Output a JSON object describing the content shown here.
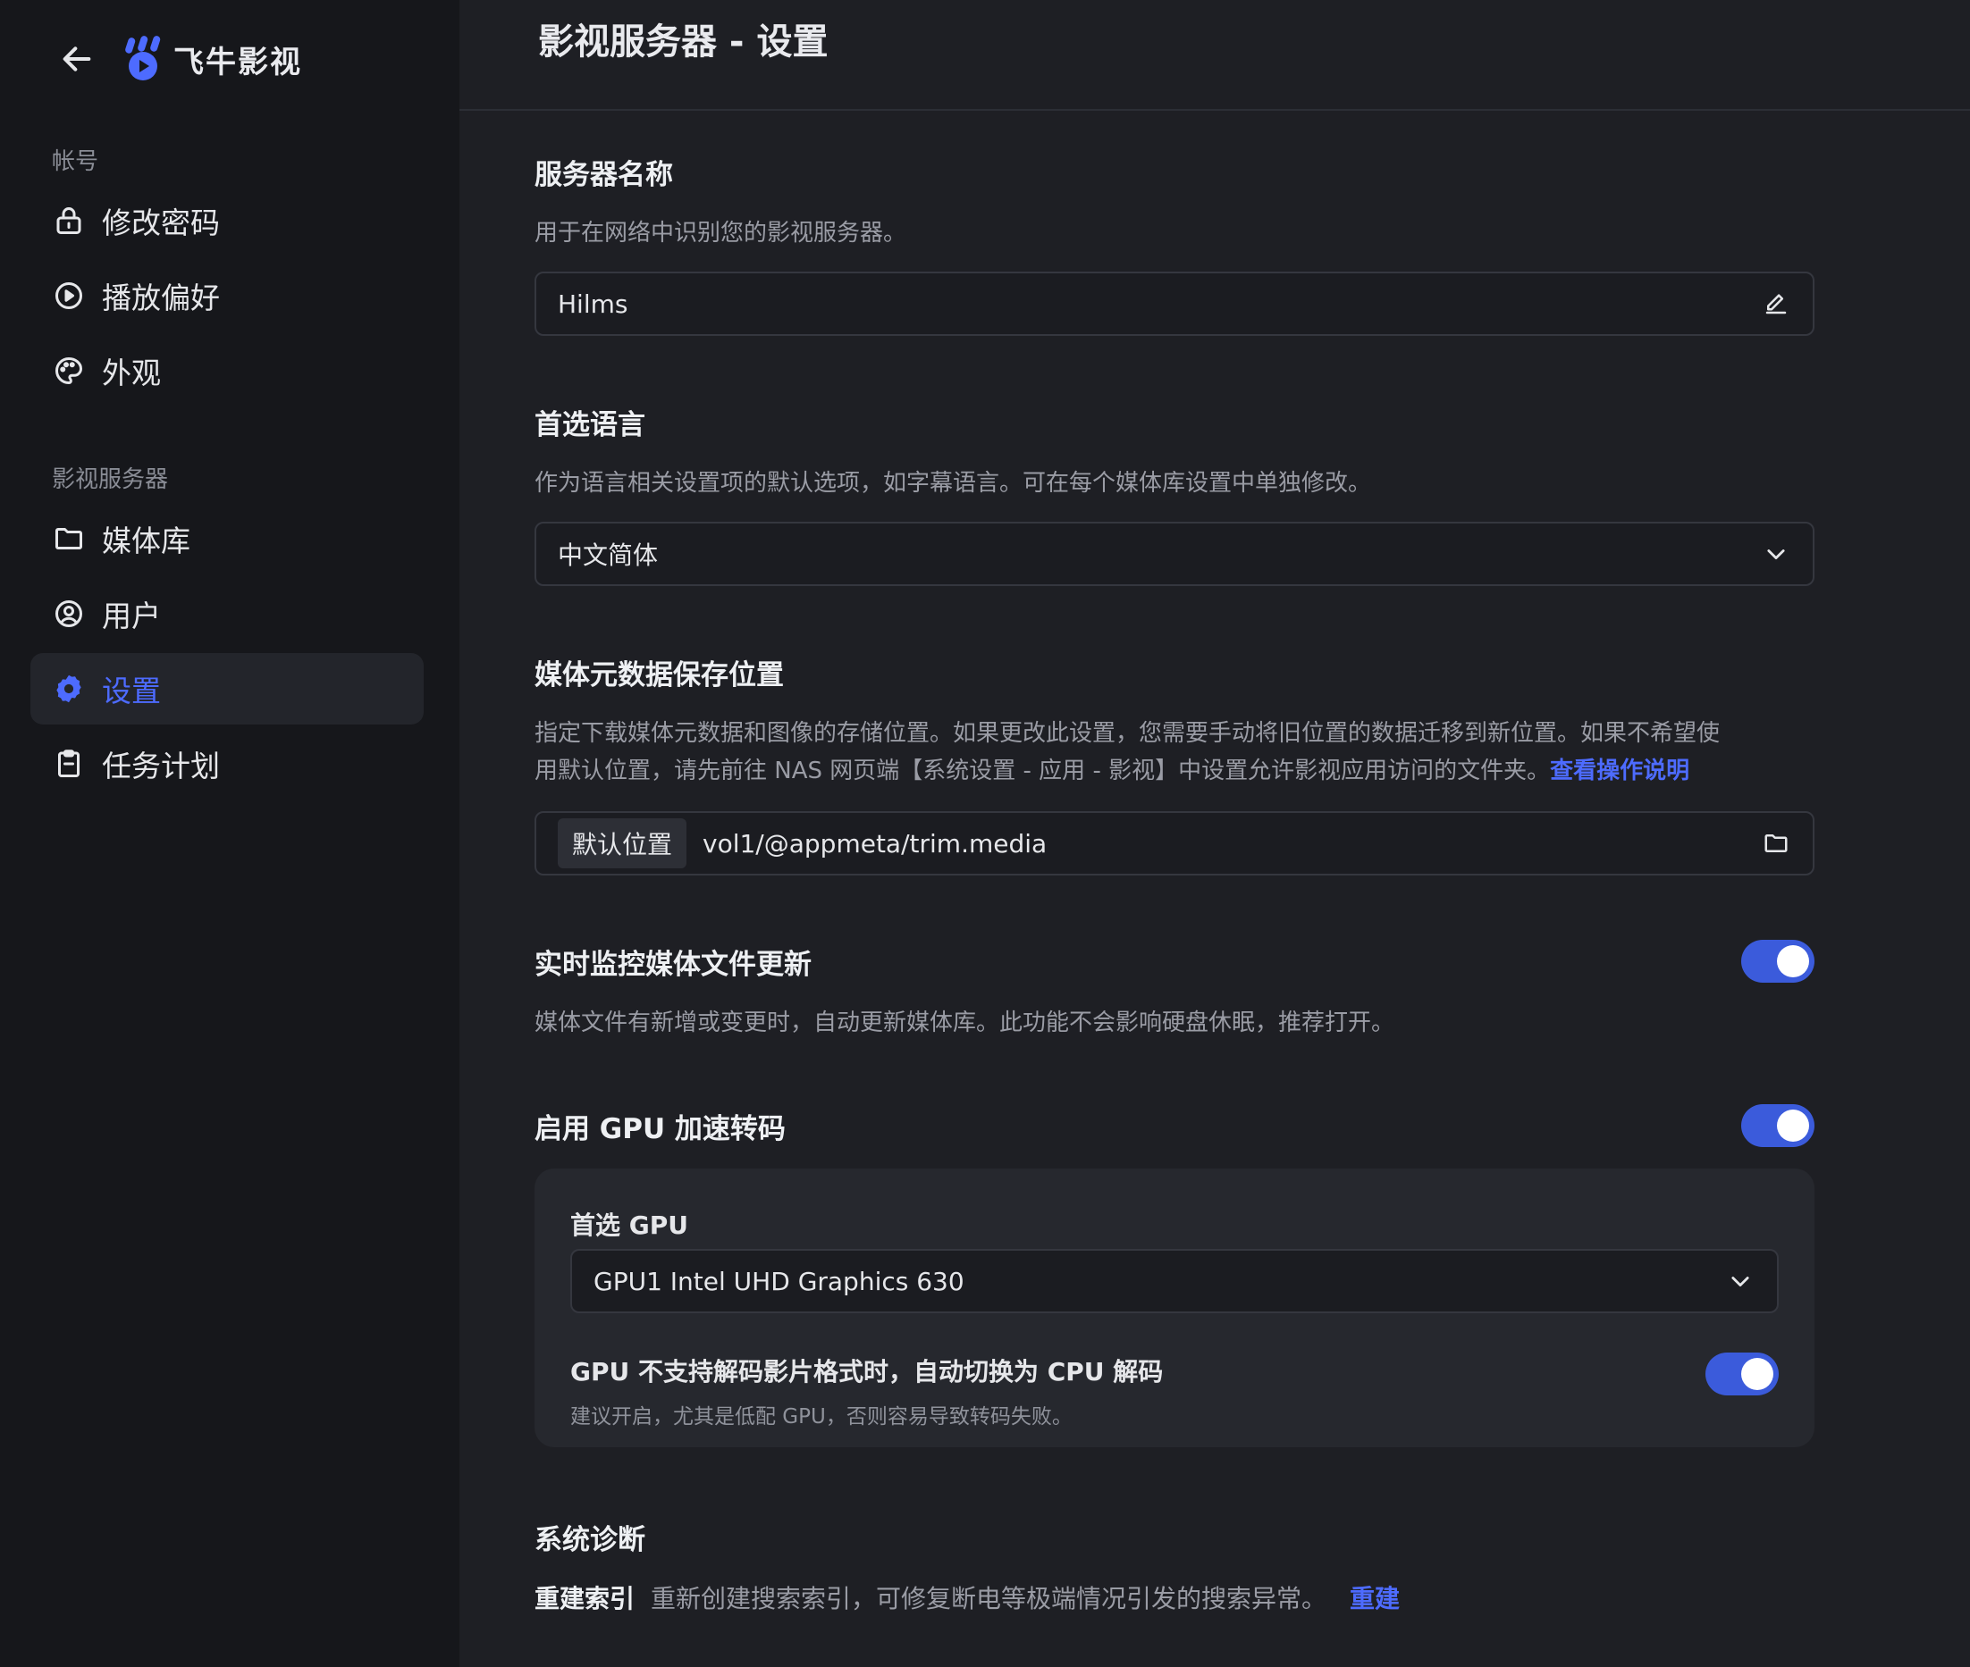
{
  "app": {
    "name": "飞牛影视",
    "back_icon": "arrow-left-icon",
    "logo_icon": "fn-logo-icon",
    "accent_color": "#4d6bff"
  },
  "sidebar": {
    "groups": [
      {
        "title": "帐号",
        "items": [
          {
            "label": "修改密码",
            "icon": "lock-icon",
            "active": false
          },
          {
            "label": "播放偏好",
            "icon": "play-circle-icon",
            "active": false
          },
          {
            "label": "外观",
            "icon": "palette-icon",
            "active": false
          }
        ]
      },
      {
        "title": "影视服务器",
        "items": [
          {
            "label": "媒体库",
            "icon": "folder-icon",
            "active": false
          },
          {
            "label": "用户",
            "icon": "user-circle-icon",
            "active": false
          },
          {
            "label": "设置",
            "icon": "gear-icon",
            "active": true
          },
          {
            "label": "任务计划",
            "icon": "clipboard-icon",
            "active": false
          }
        ]
      }
    ]
  },
  "header": {
    "title": "影视服务器 - 设置"
  },
  "settings": {
    "server_name": {
      "title": "服务器名称",
      "desc": "用于在网络中识别您的影视服务器。",
      "value": "Hilms",
      "icon": "edit-icon"
    },
    "language": {
      "title": "首选语言",
      "desc": "作为语言相关设置项的默认选项，如字幕语言。可在每个媒体库设置中单独修改。",
      "value": "中文简体",
      "icon": "chevron-down-icon"
    },
    "metadata": {
      "title": "媒体元数据保存位置",
      "desc_line1": "指定下载媒体元数据和图像的存储位置。如果更改此设置，您需要手动将旧位置的数据迁移到新位置。如果不希望使",
      "desc_line2": "用默认位置，请先前往 NAS 网页端【系统设置 - 应用 - 影视】中设置允许影视应用访问的文件夹。",
      "link": "查看操作说明",
      "chip": "默认位置",
      "path": "vol1/@appmeta/trim.media",
      "icon": "folder-icon"
    },
    "monitor": {
      "title": "实时监控媒体文件更新",
      "desc": "媒体文件有新增或变更时，自动更新媒体库。此功能不会影响硬盘休眠，推荐打开。",
      "enabled": true
    },
    "gpu": {
      "title": "启用 GPU 加速转码",
      "enabled": true,
      "preferred_label": "首选 GPU",
      "preferred_value": "GPU1 Intel UHD Graphics 630",
      "fallback_title": "GPU 不支持解码影片格式时，自动切换为 CPU 解码",
      "fallback_desc": "建议开启，尤其是低配 GPU，否则容易导致转码失败。",
      "fallback_enabled": true
    },
    "diagnostics": {
      "title": "系统诊断",
      "label": "重建索引",
      "desc": "重新创建搜索索引，可修复断电等极端情况引发的搜索异常。",
      "action": "重建"
    }
  }
}
